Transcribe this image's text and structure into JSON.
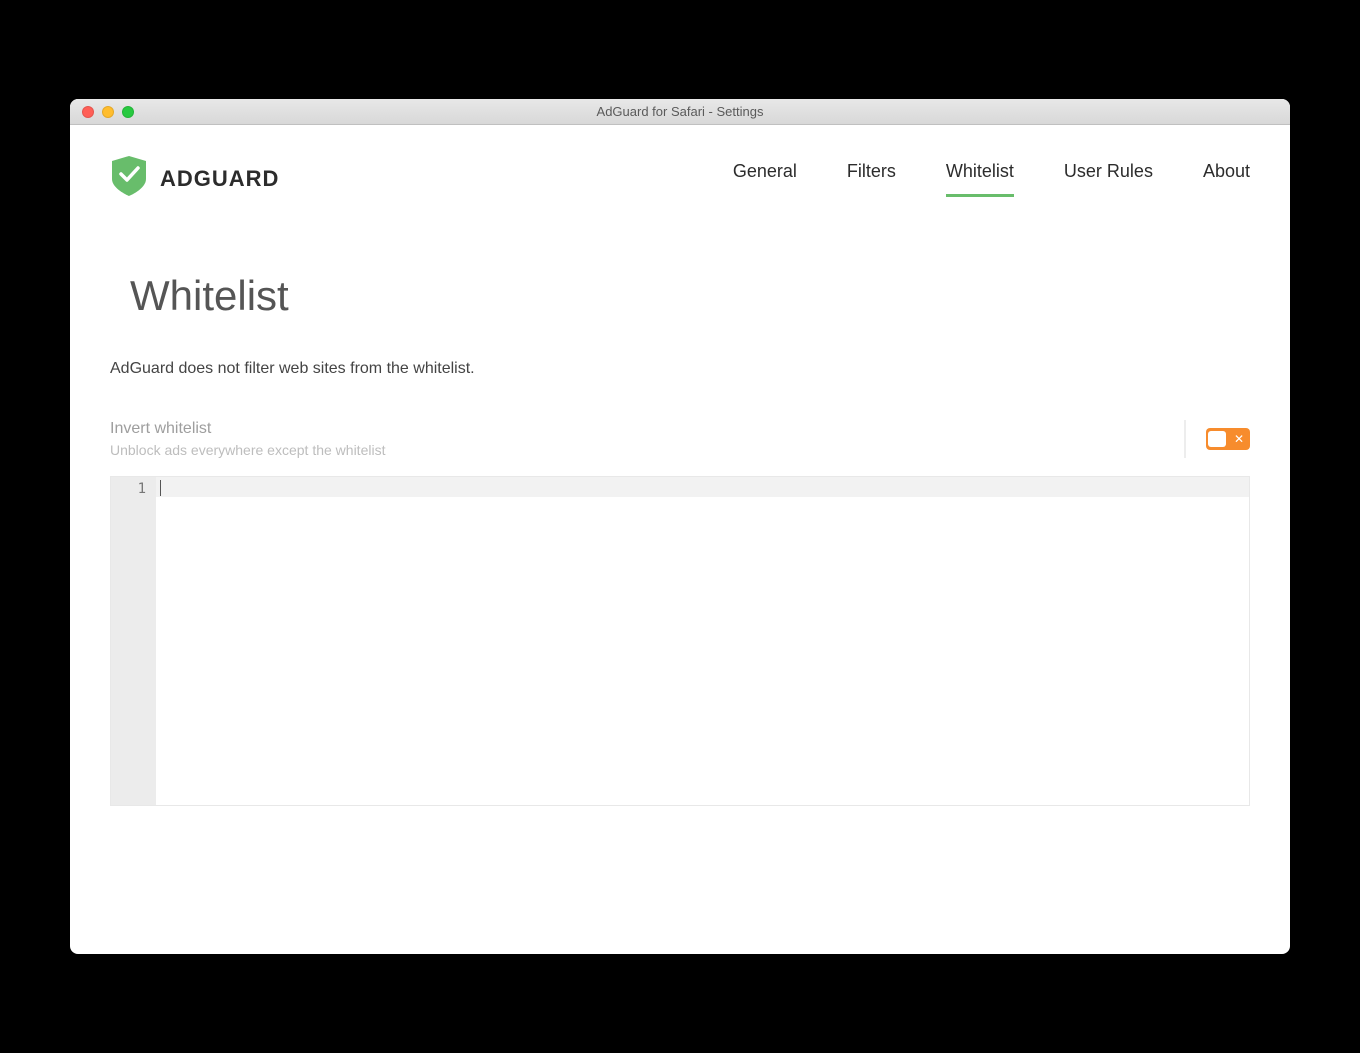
{
  "window": {
    "title": "AdGuard for Safari - Settings"
  },
  "brand": {
    "name": "ADGUARD"
  },
  "nav": {
    "items": [
      {
        "label": "General",
        "active": false
      },
      {
        "label": "Filters",
        "active": false
      },
      {
        "label": "Whitelist",
        "active": true
      },
      {
        "label": "User Rules",
        "active": false
      },
      {
        "label": "About",
        "active": false
      }
    ]
  },
  "page": {
    "title": "Whitelist",
    "description": "AdGuard does not filter web sites from the whitelist."
  },
  "setting": {
    "label": "Invert whitelist",
    "sublabel": "Unblock ads everywhere except the whitelist",
    "toggle_state": "off"
  },
  "editor": {
    "line_number": "1",
    "content": ""
  },
  "colors": {
    "accent_green": "#68bd6b",
    "accent_orange": "#f78c2d"
  }
}
